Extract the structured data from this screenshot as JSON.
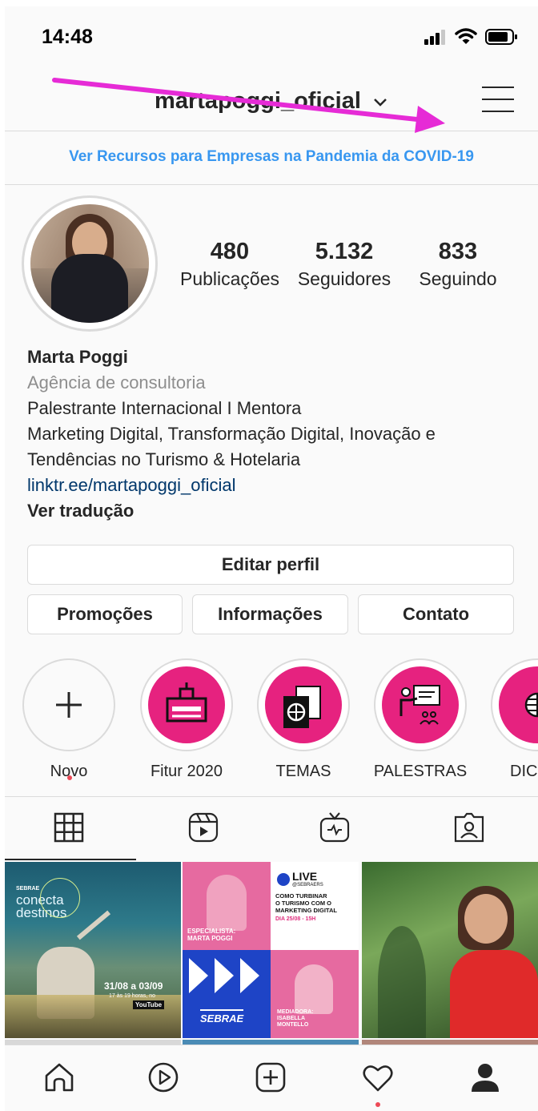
{
  "status_bar": {
    "time": "14:48"
  },
  "header": {
    "username": "martapoggi_oficial"
  },
  "banner": {
    "text": "Ver Recursos para Empresas na Pandemia da COVID-19"
  },
  "profile": {
    "stats": [
      {
        "value": "480",
        "label": "Publicações"
      },
      {
        "value": "5.132",
        "label": "Seguidores"
      },
      {
        "value": "833",
        "label": "Seguindo"
      }
    ],
    "name": "Marta Poggi",
    "category": "Agência de consultoria",
    "bio_lines": [
      "Palestrante Internacional I Mentora",
      "Marketing Digital, Transformação Digital, Inovação e",
      "Tendências no Turismo & Hotelaria"
    ],
    "link": "linktr.ee/martapoggi_oficial",
    "translate": "Ver tradução"
  },
  "buttons": {
    "edit_profile": "Editar perfil",
    "promotions": "Promoções",
    "info": "Informações",
    "contact": "Contato"
  },
  "highlights": [
    {
      "label": "Novo",
      "icon": "plus-icon"
    },
    {
      "label": "Fitur 2020",
      "icon": "building-icon"
    },
    {
      "label": "TEMAS",
      "icon": "passport-icon"
    },
    {
      "label": "PALESTRAS",
      "icon": "presenter-icon"
    },
    {
      "label": "DIC",
      "icon": "globe-icon"
    }
  ],
  "tabs": [
    "grid-icon",
    "reels-icon",
    "igtv-icon",
    "tagged-icon"
  ],
  "posts": [
    {
      "brand": "SEBRAE",
      "title": [
        "conecta",
        "destinos"
      ],
      "date": "31/08 a 03/09",
      "hours": "17 às 19 horas, no",
      "channel": "YouTube"
    },
    {
      "badge": "LIVE",
      "handle": "@SEBRAERS",
      "headline": [
        "COMO TURBINAR",
        "O TURISMO COM O",
        "MARKETING DIGITAL"
      ],
      "date": "DIA 25/08 - 15H",
      "specialist": [
        "ESPECIALISTA:",
        "MARTA POGGI"
      ],
      "mediator": [
        "MEDIADORA:",
        "ISABELLA",
        "MONTELLO"
      ],
      "brand": "SEBRAE"
    },
    {
      "alt": "photo"
    }
  ],
  "bottom_nav": [
    "home-icon",
    "reels-icon",
    "new-post-icon",
    "activity-icon",
    "profile-icon"
  ],
  "colors": {
    "accent_blue": "#3897f0",
    "highlight_pink": "#e6227f",
    "annotation_arrow": "#e62bd6",
    "notification_dot": "#ed4956"
  }
}
